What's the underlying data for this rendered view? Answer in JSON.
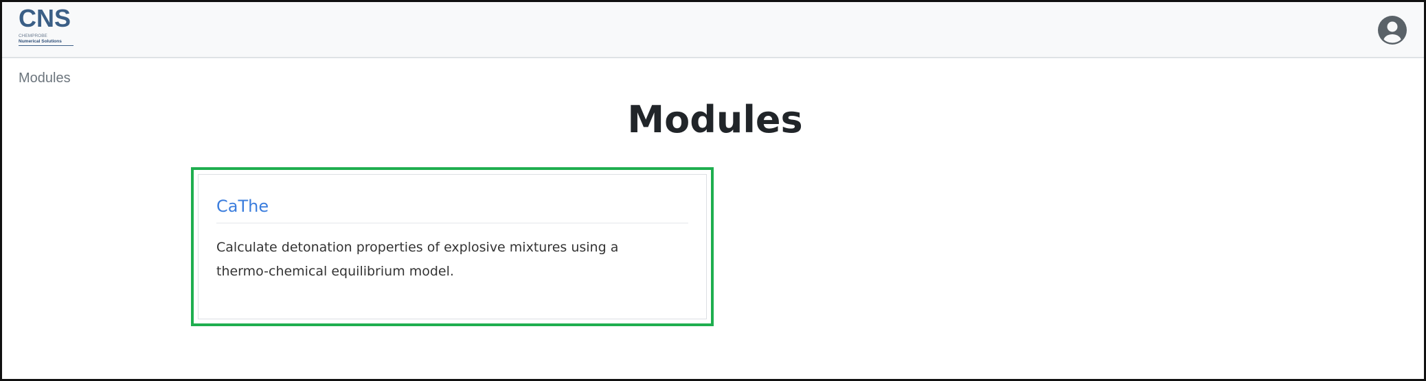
{
  "header": {
    "logo": {
      "text": "CNS",
      "subtitle_line1": "CHEMPROBE",
      "subtitle_line2": "Numerical Solutions",
      "color": "#3b5f86"
    },
    "user_icon": "user-circle-icon"
  },
  "breadcrumb": {
    "items": [
      "Modules"
    ]
  },
  "page": {
    "title": "Modules"
  },
  "modules": [
    {
      "title": "CaThe",
      "description": "Calculate detonation properties of explosive mixtures using a thermo-chemical equilibrium model."
    }
  ],
  "colors": {
    "highlight": "#1fae4f",
    "link": "#3b7ddd",
    "navbar_bg": "#f8f9fa"
  }
}
